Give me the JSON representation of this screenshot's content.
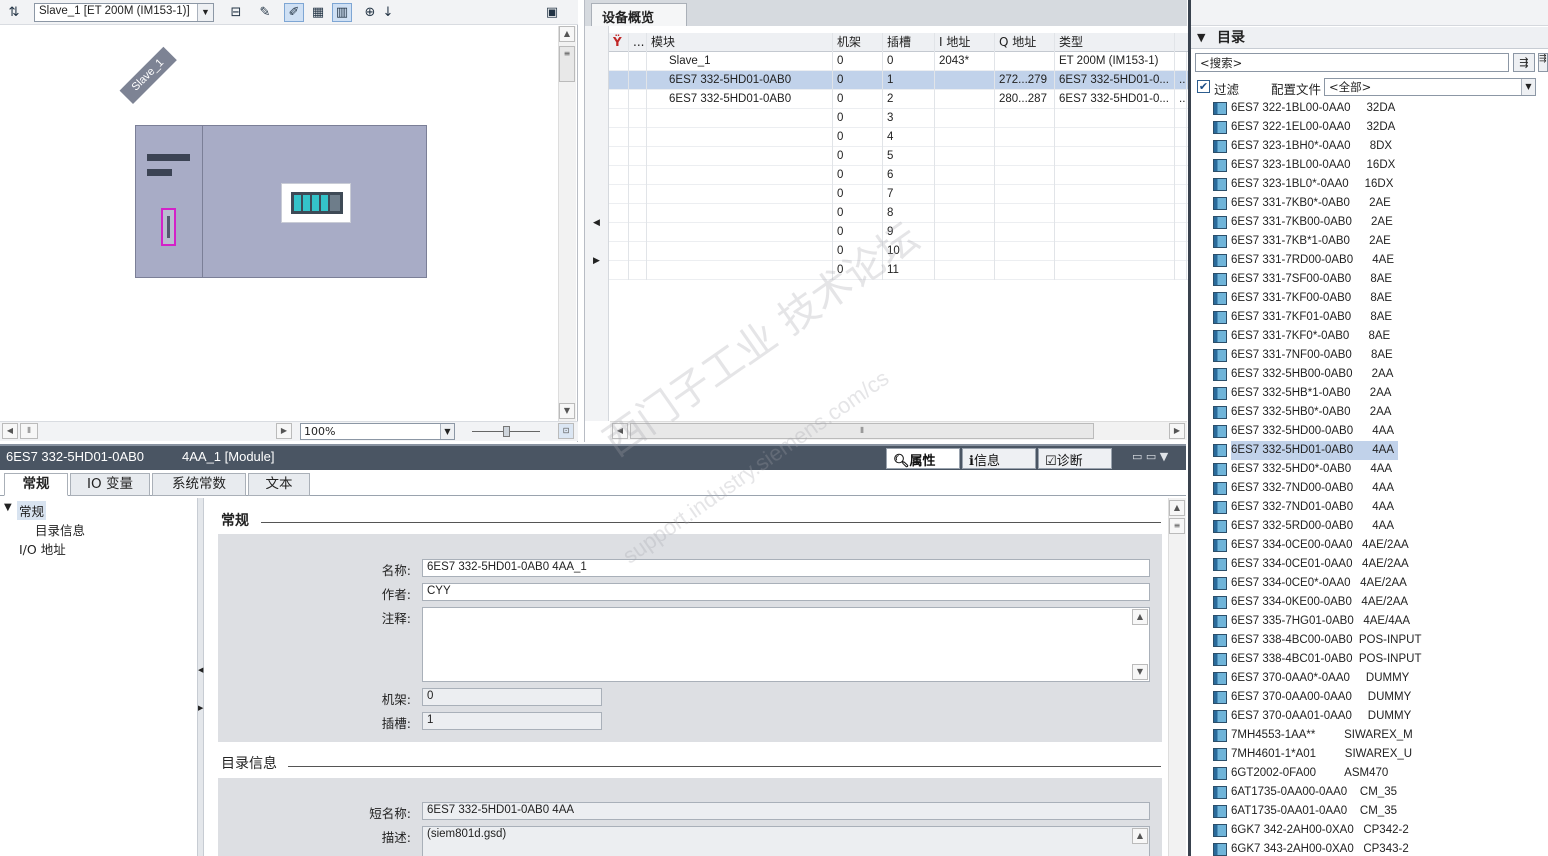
{
  "device_view": {
    "device_select": "Slave_1 [ET 200M (IM153-1)]",
    "zoom": "100%",
    "device_label": "Slave_1",
    "toolbar_icons": [
      "network-icon",
      "grid-icon",
      "rename-icon",
      "pen-icon",
      "table-icon",
      "page-icon",
      "zoom-icon",
      "download-icon",
      "overview-icon"
    ]
  },
  "overview": {
    "tab": "设备概览",
    "columns": [
      "",
      "...",
      "模块",
      "机架",
      "插槽",
      "I 地址",
      "Q 地址",
      "类型"
    ],
    "rows": [
      {
        "module": "Slave_1",
        "rack": "0",
        "slot": "0",
        "i_addr": "2043*",
        "q_addr": "",
        "type": "ET 200M (IM153-1)",
        "more": ""
      },
      {
        "module": "6ES7 332-5HD01-0AB0",
        "rack": "0",
        "slot": "1",
        "i_addr": "",
        "q_addr": "272...279",
        "type": "6ES7 332-5HD01-0...",
        "more": "..."
      },
      {
        "module": "6ES7 332-5HD01-0AB0",
        "rack": "0",
        "slot": "2",
        "i_addr": "",
        "q_addr": "280...287",
        "type": "6ES7 332-5HD01-0...",
        "more": "..."
      },
      {
        "module": "",
        "rack": "0",
        "slot": "3",
        "i_addr": "",
        "q_addr": "",
        "type": "",
        "more": ""
      },
      {
        "module": "",
        "rack": "0",
        "slot": "4",
        "i_addr": "",
        "q_addr": "",
        "type": "",
        "more": ""
      },
      {
        "module": "",
        "rack": "0",
        "slot": "5",
        "i_addr": "",
        "q_addr": "",
        "type": "",
        "more": ""
      },
      {
        "module": "",
        "rack": "0",
        "slot": "6",
        "i_addr": "",
        "q_addr": "",
        "type": "",
        "more": ""
      },
      {
        "module": "",
        "rack": "0",
        "slot": "7",
        "i_addr": "",
        "q_addr": "",
        "type": "",
        "more": ""
      },
      {
        "module": "",
        "rack": "0",
        "slot": "8",
        "i_addr": "",
        "q_addr": "",
        "type": "",
        "more": ""
      },
      {
        "module": "",
        "rack": "0",
        "slot": "9",
        "i_addr": "",
        "q_addr": "",
        "type": "",
        "more": ""
      },
      {
        "module": "",
        "rack": "0",
        "slot": "10",
        "i_addr": "",
        "q_addr": "",
        "type": "",
        "more": ""
      },
      {
        "module": "",
        "rack": "0",
        "slot": "11",
        "i_addr": "",
        "q_addr": "",
        "type": "",
        "more": ""
      }
    ],
    "selected_row": 1
  },
  "properties": {
    "title": "6ES7 332-5HD01-0AB0",
    "title2": "4AA_1 [Module]",
    "top_tabs": [
      "属性",
      "信息",
      "诊断"
    ],
    "tabs": [
      "常规",
      "IO 变量",
      "系统常数",
      "文本"
    ],
    "tree": [
      "常规",
      "目录信息",
      "I/O 地址"
    ],
    "general_section": "常规",
    "fields": {
      "name_label": "名称:",
      "name_value": "6ES7 332-5HD01-0AB0       4AA_1",
      "author_label": "作者:",
      "author_value": "CYY",
      "comment_label": "注释:",
      "comment_value": "",
      "rack_label": "机架:",
      "rack_value": "0",
      "slot_label": "插槽:",
      "slot_value": "1"
    },
    "catalog_section": "目录信息",
    "catalog_fields": {
      "short_label": "短名称:",
      "short_value": "6ES7 332-5HD01-0AB0       4AA",
      "desc_label": "描述:",
      "desc_value": "(siem801d.gsd)"
    }
  },
  "catalog": {
    "header": "目录",
    "search_placeholder": "<搜索>",
    "filter_label": "过滤",
    "filter_checked": true,
    "profile_label": "配置文件",
    "profile_value": "<全部>",
    "items": [
      "6ES7 322-1BL00-0AA0     32DA",
      "6ES7 322-1EL00-0AA0     32DA",
      "6ES7 323-1BH0*-0AA0      8DX",
      "6ES7 323-1BL00-0AA0     16DX",
      "6ES7 323-1BL0*-0AA0     16DX",
      "6ES7 331-7KB0*-0AB0      2AE",
      "6ES7 331-7KB00-0AB0      2AE",
      "6ES7 331-7KB*1-0AB0      2AE",
      "6ES7 331-7RD00-0AB0      4AE",
      "6ES7 331-7SF00-0AB0      8AE",
      "6ES7 331-7KF00-0AB0      8AE",
      "6ES7 331-7KF01-0AB0      8AE",
      "6ES7 331-7KF0*-0AB0      8AE",
      "6ES7 331-7NF00-0AB0      8AE",
      "6ES7 332-5HB00-0AB0      2AA",
      "6ES7 332-5HB*1-0AB0      2AA",
      "6ES7 332-5HB0*-0AB0      2AA",
      "6ES7 332-5HD00-0AB0      4AA",
      "6ES7 332-5HD01-0AB0      4AA",
      "6ES7 332-5HD0*-0AB0      4AA",
      "6ES7 332-7ND00-0AB0      4AA",
      "6ES7 332-7ND01-0AB0      4AA",
      "6ES7 332-5RD00-0AB0      4AA",
      "6ES7 334-0CE00-0AA0   4AE/2AA",
      "6ES7 334-0CE01-0AA0   4AE/2AA",
      "6ES7 334-0CE0*-0AA0   4AE/2AA",
      "6ES7 334-0KE00-0AB0   4AE/2AA",
      "6ES7 335-7HG01-0AB0   4AE/4AA",
      "6ES7 338-4BC00-0AB0  POS-INPUT",
      "6ES7 338-4BC01-0AB0  POS-INPUT",
      "6ES7 370-0AA0*-0AA0     DUMMY",
      "6ES7 370-0AA00-0AA0     DUMMY",
      "6ES7 370-0AA01-0AA0     DUMMY",
      "7MH4553-1AA**         SIWAREX_M",
      "7MH4601-1*A01         SIWAREX_U",
      "6GT2002-0FA00         ASM470",
      "6AT1735-0AA00-0AA0    CM_35",
      "6AT1735-0AA01-0AA0    CM_35",
      "6GK7 342-2AH00-0XA0   CP342-2",
      "6GK7 343-2AH00-0XA0   CP343-2"
    ],
    "selected_index": 18
  },
  "watermark": "西门子工业  技术论坛",
  "watermark_url": "support.industry.siemens.com/cs"
}
